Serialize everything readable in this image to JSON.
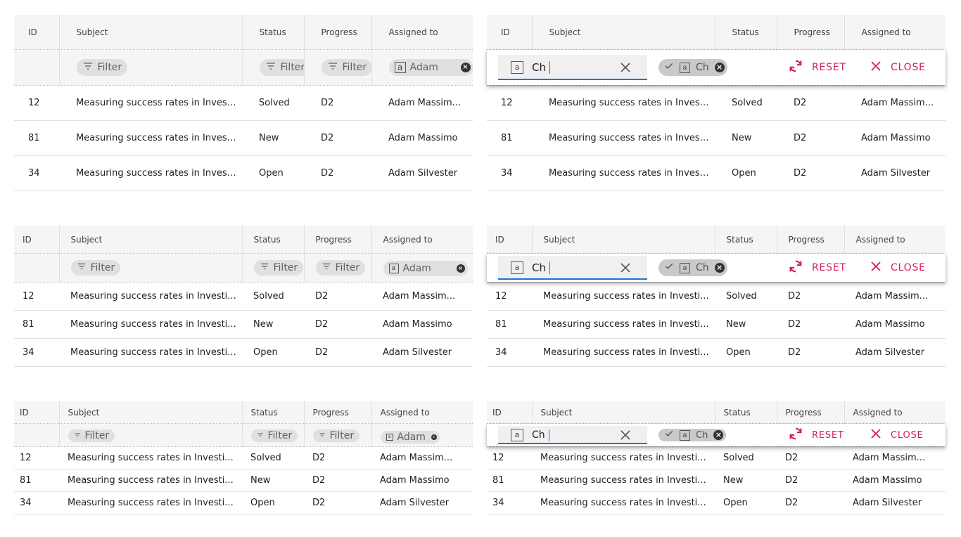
{
  "columns": [
    "ID",
    "Subject",
    "Status",
    "Progress",
    "Assigned to"
  ],
  "filter": {
    "label": "Filter",
    "assigned_value": "Adam",
    "type_icon_letter": "a"
  },
  "rows": [
    {
      "id": "12",
      "subject": "Measuring success rates in Investi...",
      "status": "Solved",
      "progress": "D2",
      "assigned": "Adam Massim..."
    },
    {
      "id": "81",
      "subject": "Measuring success rates in Investi...",
      "status": "New",
      "progress": "D2",
      "assigned": "Adam Massimo"
    },
    {
      "id": "34",
      "subject": "Measuring success rates in Investi...",
      "status": "Open",
      "progress": "D2",
      "assigned": "Adam Silvester"
    }
  ],
  "editor": {
    "input_value": "Ch",
    "chip_value": "Ch",
    "reset_label": "RESET",
    "close_label": "CLOSE"
  },
  "icons": {
    "filter": "filter-icon",
    "clear": "clear-icon",
    "check": "check-icon",
    "reset": "reset-icon",
    "close": "close-icon",
    "text-type": "text-type-icon"
  },
  "colors": {
    "accent": "#d81b60",
    "focus": "#1976d2",
    "header_bg": "#f5f5f5",
    "chip_bg": "#e0e0e0"
  }
}
